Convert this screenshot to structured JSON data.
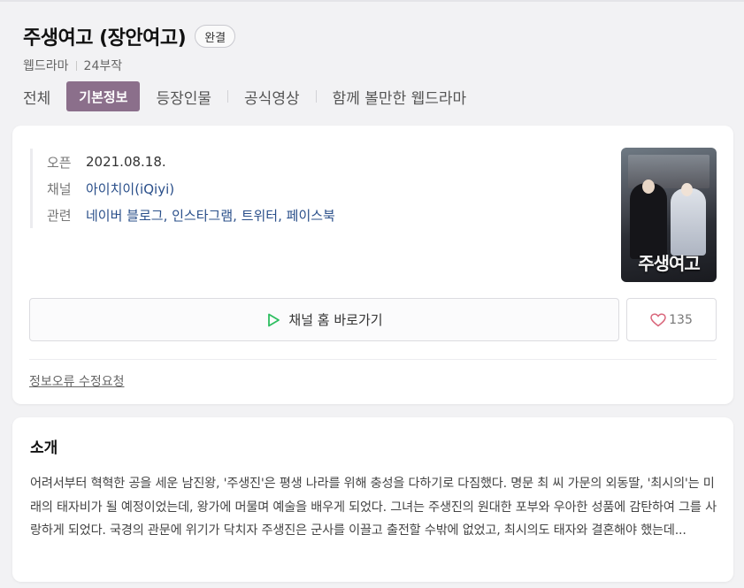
{
  "header": {
    "title": "주생여고 (장안여고)",
    "badge": "완결",
    "genre": "웹드라마",
    "episodes": "24부작"
  },
  "tabs": [
    {
      "label": "전체",
      "active": false
    },
    {
      "label": "기본정보",
      "active": true
    },
    {
      "label": "등장인물",
      "active": false
    },
    {
      "label": "공식영상",
      "active": false
    },
    {
      "label": "함께 볼만한 웹드라마",
      "active": false
    }
  ],
  "info": {
    "open_label": "오픈",
    "open_value": "2021.08.18.",
    "channel_label": "채널",
    "channel_value": "아이치이(iQiyi)",
    "related_label": "관련",
    "related_links": [
      "네이버 블로그",
      "인스타그램",
      "트위터",
      "페이스북"
    ],
    "poster_title": "주생여고"
  },
  "actions": {
    "home_button": "채널 홈 바로가기",
    "like_count": "135",
    "report_link": "정보오류 수정요청"
  },
  "intro": {
    "title": "소개",
    "text": "어려서부터 혁혁한 공을 세운 남진왕, '주생진'은 평생 나라를 위해 충성을 다하기로 다짐했다. 명문 최 씨 가문의 외동딸, '최시의'는 미래의 태자비가 될 예정이었는데, 왕가에 머물며 예술을 배우게 되었다. 그녀는 주생진의 원대한 포부와 우아한 성품에 감탄하여 그를 사랑하게 되었다. 국경의 관문에 위기가 닥치자 주생진은 군사를 이끌고 출전할 수밖에 없었고, 최시의도 태자와 결혼해야 했는데..."
  },
  "colors": {
    "accent": "#8b6f8b",
    "link": "#2a4f8a",
    "play_icon": "#2dbe60",
    "heart_icon": "#d9657a"
  }
}
